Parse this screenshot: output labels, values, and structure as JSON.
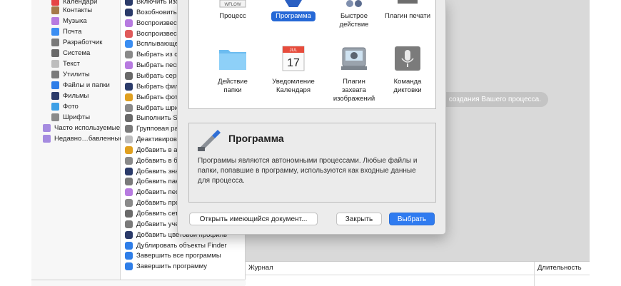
{
  "library": {
    "items": [
      {
        "label": "Календари",
        "icon": "calendar-icon",
        "color": "#e64545"
      },
      {
        "label": "Контакты",
        "icon": "contacts-icon",
        "color": "#a57a4a"
      },
      {
        "label": "Музыка",
        "icon": "music-icon",
        "color": "#b77be0"
      },
      {
        "label": "Почта",
        "icon": "mail-icon",
        "color": "#3b8ef2"
      },
      {
        "label": "Разработчик",
        "icon": "developer-tools-icon",
        "color": "#7a7a7a"
      },
      {
        "label": "Система",
        "icon": "system-gear-icon",
        "color": "#6a6a6a"
      },
      {
        "label": "Текст",
        "icon": "text-icon",
        "color": "#bdbdbd"
      },
      {
        "label": "Утилиты",
        "icon": "utilities-icon",
        "color": "#7a7a7a"
      },
      {
        "label": "Файлы и папки",
        "icon": "finder-icon",
        "color": "#2f7ee8"
      },
      {
        "label": "Фильмы",
        "icon": "movies-icon",
        "color": "#2b3b6a"
      },
      {
        "label": "Фото",
        "icon": "photos-icon",
        "color": "#3da0e6"
      },
      {
        "label": "Шрифты",
        "icon": "fonts-icon",
        "color": "#8a8a8a"
      },
      {
        "label": "Часто используемые",
        "icon": "folder-smart-icon",
        "color": "#a58be0"
      },
      {
        "label": "Недавно…бавленные",
        "icon": "folder-smart-icon",
        "color": "#a58be0"
      }
    ]
  },
  "actions": {
    "items": [
      {
        "label": "Включить изо",
        "icon": "quicktime-icon",
        "color": "#2b3b6a"
      },
      {
        "label": "Возобновить",
        "icon": "quicktime-icon",
        "color": "#2b3b6a"
      },
      {
        "label": "Воспроизвест",
        "icon": "itunes-icon",
        "color": "#b77be0"
      },
      {
        "label": "Воспроизвест",
        "icon": "photos-icon",
        "color": "#e05a5a"
      },
      {
        "label": "Всплывающе",
        "icon": "safari-icon",
        "color": "#3b8ef2"
      },
      {
        "label": "Выбрать из с",
        "icon": "script-icon",
        "color": "#8a8a8a"
      },
      {
        "label": "Выбрать песн",
        "icon": "itunes-icon",
        "color": "#b77be0"
      },
      {
        "label": "Выбрать серв",
        "icon": "network-icon",
        "color": "#6a6a6a"
      },
      {
        "label": "Выбрать фил",
        "icon": "quicktime-icon",
        "color": "#2b3b6a"
      },
      {
        "label": "Выбрать фото",
        "icon": "photos-icon",
        "color": "#e0a020"
      },
      {
        "label": "Выбрать шри",
        "icon": "fonts-icon",
        "color": "#8a8a8a"
      },
      {
        "label": "Выполнить Sh",
        "icon": "developer-tools-icon",
        "color": "#6a6a6a"
      },
      {
        "label": "Групповая ра",
        "icon": "automator-icon",
        "color": "#7a7a7a"
      },
      {
        "label": "Деактивиров",
        "icon": "text-icon",
        "color": "#bdbdbd"
      },
      {
        "label": "Добавить в а",
        "icon": "photos-icon",
        "color": "#e0a020"
      },
      {
        "label": "Добавить в б",
        "icon": "script-icon",
        "color": "#8a8a8a"
      },
      {
        "label": "Добавить зна",
        "icon": "quicktime-icon",
        "color": "#2b3b6a"
      },
      {
        "label": "Добавить пак",
        "icon": "automator-icon",
        "color": "#7a7a7a"
      },
      {
        "label": "Добавить пес",
        "icon": "itunes-icon",
        "color": "#b77be0"
      },
      {
        "label": "Добавить про",
        "icon": "script-icon",
        "color": "#8a8a8a"
      },
      {
        "label": "Добавить сет",
        "icon": "network-icon",
        "color": "#6a6a6a"
      },
      {
        "label": "Добавить уче",
        "icon": "automator-icon",
        "color": "#7a7a7a"
      },
      {
        "label": "Добавить цветовой профиль",
        "icon": "quicktime-icon",
        "color": "#2b3b6a"
      },
      {
        "label": "Дублировать объекты Finder",
        "icon": "finder-icon",
        "color": "#2f7ee8"
      },
      {
        "label": "Завершить все программы",
        "icon": "finder-icon",
        "color": "#2f7ee8"
      },
      {
        "label": "Завершить программу",
        "icon": "finder-icon",
        "color": "#2f7ee8"
      }
    ]
  },
  "workflow": {
    "hint": "создания Вашего процесса."
  },
  "log": {
    "col_journal": "Журнал",
    "col_duration": "Длительность"
  },
  "sheet": {
    "row1": [
      {
        "label": "Процесс",
        "icon": "workflow-icon",
        "icon_text": "WFLOW",
        "selected": false
      },
      {
        "label": "Программа",
        "icon": "application-icon",
        "selected": true
      },
      {
        "label": "Быстрое\nдействие",
        "icon": "quick-action-icon",
        "selected": false
      },
      {
        "label": "Плагин печати",
        "icon": "print-plugin-icon",
        "selected": false
      }
    ],
    "row2": [
      {
        "label": "Действие\nпапки",
        "icon": "folder-action-icon",
        "selected": false
      },
      {
        "label": "Уведомление\nКалендаря",
        "icon": "calendar-alarm-icon",
        "cal_month": "JUL",
        "cal_day": "17",
        "selected": false
      },
      {
        "label": "Плагин\nзахвата\nизображений",
        "icon": "image-capture-icon",
        "selected": false
      },
      {
        "label": "Команда\nдиктовки",
        "icon": "dictation-icon",
        "selected": false
      }
    ],
    "desc_title": "Программа",
    "desc_text": "Программы являются автономными процессами. Любые файлы и папки, попавшие в программу, используются как входные данные для процесса.",
    "btn_open": "Открыть имеющийся документ...",
    "btn_close": "Закрыть",
    "btn_choose": "Выбрать",
    "accent": "#2f7bf0"
  }
}
